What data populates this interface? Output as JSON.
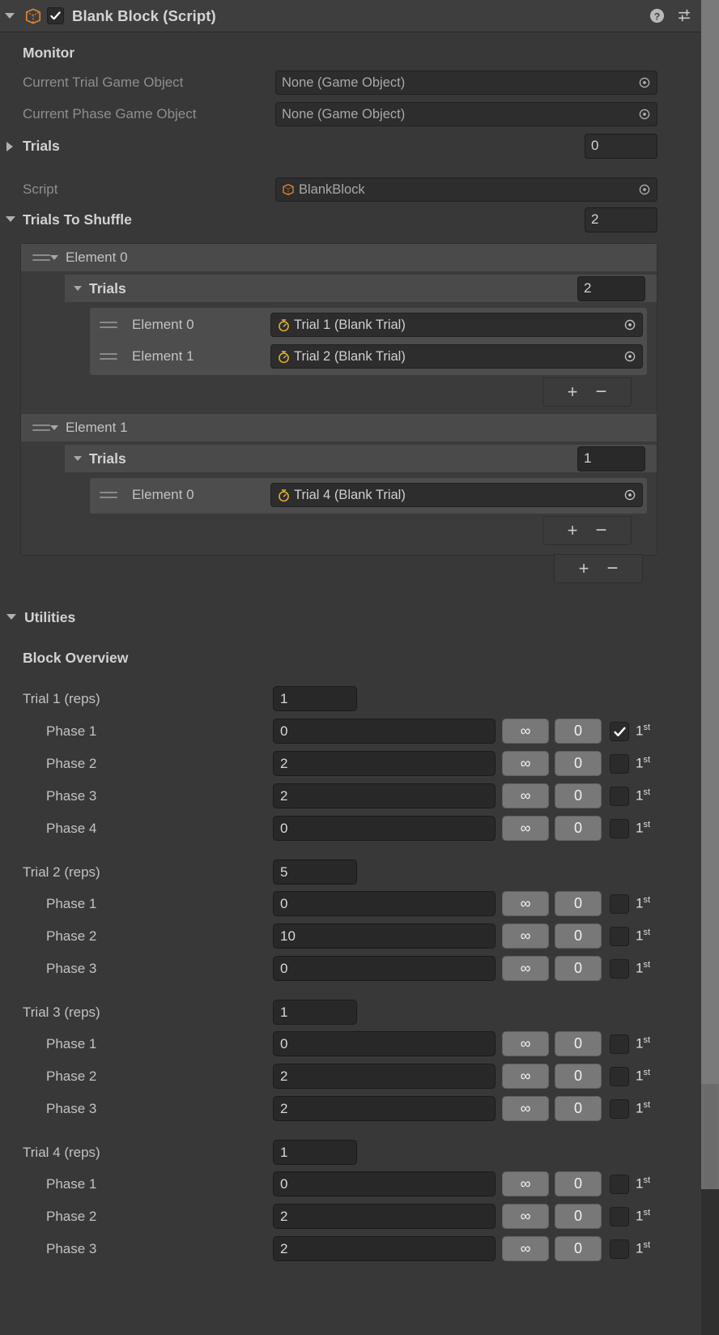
{
  "header": {
    "title": "Blank Block (Script)",
    "enabled": true,
    "icon": "script-cube-icon",
    "help_icon": "help-icon",
    "preset_icon": "preset-sliders-icon",
    "menu_icon": "kebab-menu-icon"
  },
  "monitor": {
    "section_label": "Monitor",
    "fields": [
      {
        "label": "Current Trial Game Object",
        "value": "None (Game Object)"
      },
      {
        "label": "Current Phase Game Object",
        "value": "None (Game Object)"
      }
    ],
    "trials": {
      "label": "Trials",
      "count": "0",
      "expanded": false
    }
  },
  "script_row": {
    "label": "Script",
    "value": "BlankBlock"
  },
  "trials_to_shuffle": {
    "label": "Trials To Shuffle",
    "count": "2",
    "expanded": true,
    "elements": [
      {
        "label": "Element 0",
        "trials_label": "Trials",
        "trials_count": "2",
        "items": [
          {
            "label": "Element 0",
            "value": "Trial 1 (Blank Trial)"
          },
          {
            "label": "Element 1",
            "value": "Trial 2 (Blank Trial)"
          }
        ]
      },
      {
        "label": "Element 1",
        "trials_label": "Trials",
        "trials_count": "1",
        "items": [
          {
            "label": "Element 0",
            "value": "Trial 4 (Blank Trial)"
          }
        ]
      }
    ],
    "add_label": "+",
    "remove_label": "−"
  },
  "utilities": {
    "label": "Utilities",
    "expanded": true,
    "block_overview_label": "Block Overview",
    "infinity_label": "∞",
    "zero_label": "0",
    "ordinal_number": "1",
    "ordinal_suffix": "st",
    "trials": [
      {
        "label": "Trial 1 (reps)",
        "reps": "1",
        "phases": [
          {
            "label": "Phase 1",
            "value": "0",
            "infinity": "∞",
            "zero": "0",
            "checked": true
          },
          {
            "label": "Phase 2",
            "value": "2",
            "infinity": "∞",
            "zero": "0",
            "checked": false
          },
          {
            "label": "Phase 3",
            "value": "2",
            "infinity": "∞",
            "zero": "0",
            "checked": false
          },
          {
            "label": "Phase 4",
            "value": "0",
            "infinity": "∞",
            "zero": "0",
            "checked": false
          }
        ]
      },
      {
        "label": "Trial 2 (reps)",
        "reps": "5",
        "phases": [
          {
            "label": "Phase 1",
            "value": "0",
            "infinity": "∞",
            "zero": "0",
            "checked": false
          },
          {
            "label": "Phase 2",
            "value": "10",
            "infinity": "∞",
            "zero": "0",
            "checked": false
          },
          {
            "label": "Phase 3",
            "value": "0",
            "infinity": "∞",
            "zero": "0",
            "checked": false
          }
        ]
      },
      {
        "label": "Trial 3 (reps)",
        "reps": "1",
        "phases": [
          {
            "label": "Phase 1",
            "value": "0",
            "infinity": "∞",
            "zero": "0",
            "checked": false
          },
          {
            "label": "Phase 2",
            "value": "2",
            "infinity": "∞",
            "zero": "0",
            "checked": false
          },
          {
            "label": "Phase 3",
            "value": "2",
            "infinity": "∞",
            "zero": "0",
            "checked": false
          }
        ]
      },
      {
        "label": "Trial 4 (reps)",
        "reps": "1",
        "phases": [
          {
            "label": "Phase 1",
            "value": "0",
            "infinity": "∞",
            "zero": "0",
            "checked": false
          },
          {
            "label": "Phase 2",
            "value": "2",
            "infinity": "∞",
            "zero": "0",
            "checked": false
          },
          {
            "label": "Phase 3",
            "value": "2",
            "infinity": "∞",
            "zero": "0",
            "checked": false
          }
        ]
      }
    ]
  },
  "colors": {
    "background": "#383838",
    "header_bar": "#3e3e3e",
    "field": "#2d2d2d",
    "accent_orange": "#e08020",
    "accent_yellow": "#e8b233",
    "button_gray": "#787878",
    "scrollbar": "#6b6b6b"
  }
}
